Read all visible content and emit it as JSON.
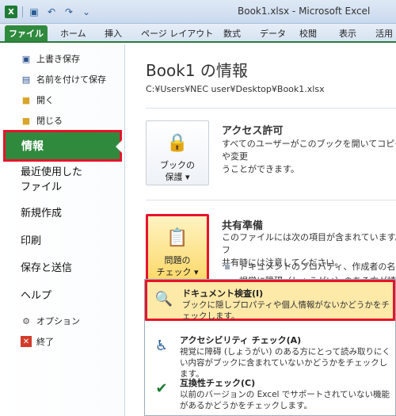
{
  "window": {
    "title": "Book1.xlsx - Microsoft Excel"
  },
  "tabs": [
    "ファイル",
    "ホーム",
    "挿入",
    "ページ レイアウト",
    "数式",
    "データ",
    "校閲",
    "表示",
    "活用"
  ],
  "nav": {
    "save": "上書き保存",
    "save_as": "名前を付けて保存",
    "open": "開く",
    "close": "閉じる",
    "info": "情報",
    "recent": "最近使用した\nファイル",
    "new": "新規作成",
    "print": "印刷",
    "save_send": "保存と送信",
    "help": "ヘルプ",
    "options": "オプション",
    "exit": "終了"
  },
  "main": {
    "title": "Book1 の情報",
    "path": "C:¥Users¥NEC user¥Desktop¥Book1.xlsx",
    "permissions": {
      "button": "ブックの\n保護 ▾",
      "title": "アクセス許可",
      "text": "すべてのユーザーがこのブックを開いてコピーや変更\nうことができます。"
    },
    "prepare": {
      "button": "問題の\nチェック ▾",
      "title": "共有準備",
      "text": "このファイルには次の項目が含まれています。フ\n共有時には注意してください。",
      "bullet1": "ドキュメントのプロパティ、作成者の名前",
      "bullet2": "視覚に障碍（しょうがい）のある方が読み"
    }
  },
  "menu": [
    {
      "title": "ドキュメント検査(I)",
      "desc": "ブックに隠しプロパティや個人情報がないかどうかをチェックします。"
    },
    {
      "title": "アクセシビリティ チェック(A)",
      "desc": "視覚に障碍 (しょうがい) のある方にとって読み取りにくい内容がブックに含まれていないかどうかをチェックします。"
    },
    {
      "title": "互換性チェック(C)",
      "desc": "以前のバージョンの Excel でサポートされていない機能があるかどうかをチェックします。"
    }
  ]
}
